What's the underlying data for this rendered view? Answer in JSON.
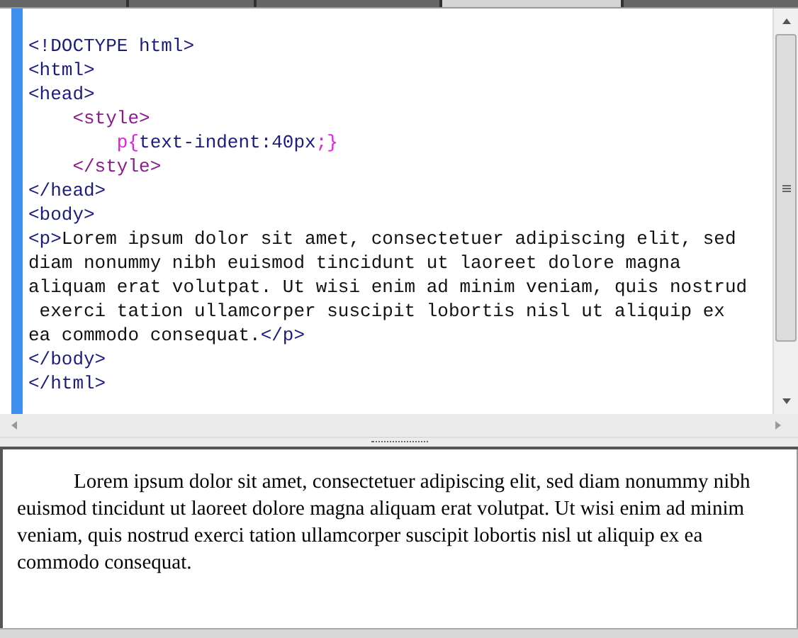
{
  "tabs": [
    {
      "selected": false
    },
    {
      "selected": false
    },
    {
      "selected": false
    },
    {
      "selected": true
    },
    {
      "selected": false
    }
  ],
  "editor": {
    "lines": [
      [
        {
          "kind": "tag",
          "text": "<!DOCTYPE html>"
        }
      ],
      [
        {
          "kind": "tag",
          "text": "<html>"
        }
      ],
      [
        {
          "kind": "tag",
          "text": "<head>"
        }
      ],
      [
        {
          "kind": "style-tag",
          "text": "    <style>"
        }
      ],
      [
        {
          "kind": "selector",
          "text": "        p{"
        },
        {
          "kind": "property",
          "text": "text-indent:40px"
        },
        {
          "kind": "selector",
          "text": ";}"
        }
      ],
      [
        {
          "kind": "style-tag",
          "text": "    </style>"
        }
      ],
      [
        {
          "kind": "tag",
          "text": "</head>"
        }
      ],
      [
        {
          "kind": "tag",
          "text": "<body>"
        }
      ],
      [
        {
          "kind": "tag",
          "text": "<p>"
        },
        {
          "kind": "text",
          "text": "Lorem ipsum dolor sit amet, consectetuer adipiscing elit, sed"
        }
      ],
      [
        {
          "kind": "text",
          "text": "diam nonummy nibh euismod tincidunt ut laoreet dolore magna"
        }
      ],
      [
        {
          "kind": "text",
          "text": "aliquam erat volutpat. Ut wisi enim ad minim veniam, quis nostrud"
        }
      ],
      [
        {
          "kind": "text",
          "text": " exerci tation ullamcorper suscipit lobortis nisl ut aliquip ex"
        }
      ],
      [
        {
          "kind": "text",
          "text": "ea commodo consequat."
        },
        {
          "kind": "tag",
          "text": "</p>"
        }
      ],
      [
        {
          "kind": "tag",
          "text": "</body>"
        }
      ],
      [
        {
          "kind": "tag",
          "text": "</html>"
        }
      ]
    ]
  },
  "preview": {
    "paragraph": "Lorem ipsum dolor sit amet, consectetuer adipiscing elit, sed diam nonummy nibh euismod tincidunt ut laoreet dolore magna aliquam erat volutpat. Ut wisi enim ad minim veniam, quis nostrud exerci tation ullamcorper suscipit lobortis nisl ut aliquip ex ea commodo consequat."
  }
}
